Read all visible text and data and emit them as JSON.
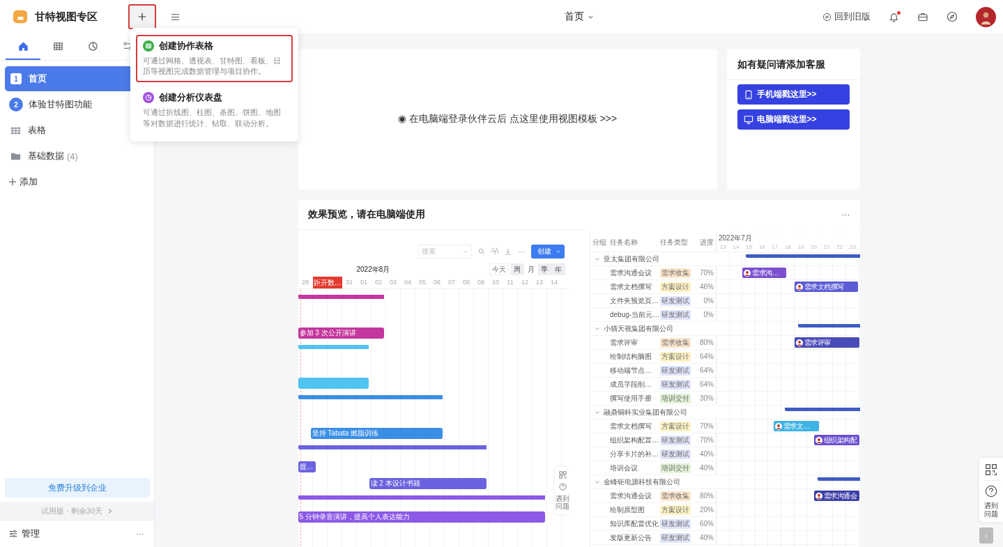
{
  "app": {
    "title": "甘特视图专区",
    "add_highlighted": true
  },
  "page_title": "首页",
  "header": {
    "old_version": "回到旧版",
    "notification_dot": true
  },
  "sidebar": {
    "tabs": [
      {
        "kind": "home",
        "selected": true
      },
      {
        "kind": "table",
        "selected": false
      },
      {
        "kind": "clock",
        "selected": false
      },
      {
        "kind": "filter",
        "selected": false
      }
    ],
    "items": [
      {
        "kind": "numbered",
        "badge": "1",
        "label": "首页",
        "selected": true
      },
      {
        "kind": "numbered",
        "badge": "2",
        "label": "体验甘特图功能",
        "selected": false
      },
      {
        "kind": "table",
        "label": "表格",
        "selected": false
      },
      {
        "kind": "folder",
        "label": "基础数据",
        "count": "(4)",
        "selected": false
      }
    ],
    "add": "添加",
    "upgrade": "免费升级到企业",
    "trial": "试用版 · 剩余30天",
    "manage": "管理",
    "more": "···"
  },
  "create_menu": [
    {
      "kind": "table",
      "title": "创建协作表格",
      "description": "可通过网格、透视表、甘特图、看板、日历等视图完成数据管理与项目协作。",
      "highlighted": true
    },
    {
      "kind": "dashboard",
      "title": "创建分析仪表盘",
      "description": "可通过折线图、柱图、条图、饼图、地图等对数据进行统计、钻取、联动分析。",
      "highlighted": false
    }
  ],
  "banner": {
    "text": "◉ 在电脑端登录伙伴云后 点这里使用视图模板 >>>"
  },
  "help_card": {
    "title": "如有疑问请添加客服",
    "buttons": [
      {
        "kind": "mobile",
        "label": "手机端戳这里>>"
      },
      {
        "kind": "desktop",
        "label": "电脑端戳这里>>"
      }
    ]
  },
  "preview": {
    "title": "效果预览，请在电脑端使用",
    "more": "···",
    "left": {
      "search_placeholder": "搜索",
      "more": "···",
      "create": "创建",
      "month": "2022年8月",
      "today": "今天",
      "scales": [
        {
          "label": "周",
          "selected": false
        },
        {
          "label": "月",
          "selected": true
        },
        {
          "label": "季",
          "selected": false
        },
        {
          "label": "年",
          "selected": false
        }
      ],
      "days": [
        {
          "kind": "day",
          "label": "28"
        },
        {
          "kind": "marker",
          "label": "距开数…"
        },
        {
          "kind": "day",
          "label": "31"
        },
        {
          "kind": "day",
          "label": "01"
        },
        {
          "kind": "day",
          "label": "02"
        },
        {
          "kind": "day",
          "label": "03"
        },
        {
          "kind": "day",
          "label": "04"
        },
        {
          "kind": "day",
          "label": "05"
        },
        {
          "kind": "day",
          "label": "06"
        },
        {
          "kind": "day",
          "label": "07"
        },
        {
          "kind": "day",
          "label": "08"
        },
        {
          "kind": "day",
          "label": "09"
        },
        {
          "kind": "day",
          "label": "10"
        },
        {
          "kind": "day",
          "label": "11"
        },
        {
          "kind": "day",
          "label": "12"
        },
        {
          "kind": "day",
          "label": "13"
        },
        {
          "kind": "day",
          "label": "14"
        }
      ],
      "bars": [
        {
          "kind": "summary",
          "color": "#c4379c"
        },
        {
          "kind": "empty"
        },
        {
          "kind": "task",
          "label": "参加 3 次公开演讲",
          "color": "#c4379c"
        },
        {
          "kind": "summary",
          "color": "#4fc3f2"
        },
        {
          "kind": "empty"
        },
        {
          "kind": "task",
          "color": "#4fc3f2"
        },
        {
          "kind": "summary",
          "color": "#3b8ee6"
        },
        {
          "kind": "empty"
        },
        {
          "kind": "task",
          "label": "坚持 Tabata 燃脂训练",
          "color": "#3b8ee6"
        },
        {
          "kind": "summary",
          "color": "#6b62e0"
        },
        {
          "kind": "task",
          "label": "提…",
          "color": "#6b62e0"
        },
        {
          "kind": "task",
          "label": "读 2 本设计书籍",
          "color": "#6b62e0"
        },
        {
          "kind": "summary",
          "color": "#8b59e6"
        },
        {
          "kind": "task",
          "label": "5 分钟录音演讲，提高个人表达能力",
          "color": "#8b59e6"
        }
      ],
      "help_label": "遇到问题"
    },
    "right": {
      "columns": [
        "分组",
        "任务名称",
        "任务类型",
        "进度"
      ],
      "month": "2022年7月",
      "days": [
        "13",
        "14",
        "15",
        "16",
        "17",
        "18",
        "19",
        "20",
        "21",
        "22",
        "23"
      ],
      "groups": [
        {
          "name": "亚太集团有限公司",
          "expanded": true,
          "tasks": [
            {
              "name": "需求沟通会议",
              "type": {
                "label": "需求收集",
                "color": "#fbe6cc"
              },
              "progress": "70%",
              "bar": {
                "label": "需求沟…",
                "color": "#7b4fd0"
              }
            },
            {
              "name": "需求文档撰写",
              "type": {
                "label": "方案设计",
                "color": "#fdf1c4"
              },
              "progress": "46%",
              "bar": {
                "label": "需求文档撰写",
                "color": "#5b5bd6"
              }
            },
            {
              "name": "文件夹预览页…",
              "type": {
                "label": "研发测试",
                "color": "#e1e5fa"
              },
              "progress": "0%"
            },
            {
              "name": "debug-当前元…",
              "type": {
                "label": "研发测试",
                "color": "#e1e5fa"
              },
              "progress": "0%"
            }
          ]
        },
        {
          "name": "小猫天视集团有限公司",
          "expanded": true,
          "tasks": [
            {
              "name": "需求评审",
              "type": {
                "label": "需求收集",
                "color": "#fbe6cc"
              },
              "progress": "80%",
              "bar": {
                "label": "需求评审",
                "color": "#4a4ab8"
              }
            },
            {
              "name": "绘制结构脑图",
              "type": {
                "label": "方案设计",
                "color": "#fdf1c4"
              },
              "progress": "64%"
            },
            {
              "name": "移动端节点…",
              "type": {
                "label": "研发测试",
                "color": "#e1e5fa"
              },
              "progress": "64%"
            },
            {
              "name": "成员字段削…",
              "type": {
                "label": "研发测试",
                "color": "#e1e5fa"
              },
              "progress": "64%"
            },
            {
              "name": "撰写使用手册",
              "type": {
                "label": "培训交付",
                "color": "#e2f2d6"
              },
              "progress": "30%"
            }
          ]
        },
        {
          "name": "融鼎铜科实业集团有限公司",
          "expanded": true,
          "tasks": [
            {
              "name": "需求文档撰写",
              "type": {
                "label": "方案设计",
                "color": "#fdf1c4"
              },
              "progress": "70%",
              "bar": {
                "label": "需求文…",
                "color": "#3fb3e6"
              }
            },
            {
              "name": "组织架构配置…",
              "type": {
                "label": "研发测试",
                "color": "#e1e5fa"
              },
              "progress": "70%",
              "bar": {
                "label": "组织架构配",
                "color": "#6b4fd0"
              }
            },
            {
              "name": "分享卡片的补…",
              "type": {
                "label": "研发测试",
                "color": "#e1e5fa"
              },
              "progress": "40%"
            },
            {
              "name": "培训会议",
              "type": {
                "label": "培训交付",
                "color": "#e2f2d6"
              },
              "progress": "40%"
            }
          ]
        },
        {
          "name": "金峰钜电源科技有限公司",
          "expanded": true,
          "tasks": [
            {
              "name": "需求沟通会议",
              "type": {
                "label": "需求收集",
                "color": "#fbe6cc"
              },
              "progress": "80%",
              "bar": {
                "label": "需求沟通会",
                "color": "#3d3fa8"
              }
            },
            {
              "name": "绘制原型图",
              "type": {
                "label": "方案设计",
                "color": "#fdf1c4"
              },
              "progress": "20%"
            },
            {
              "name": "知识库配置优化",
              "type": {
                "label": "研发测试",
                "color": "#e1e5fa"
              },
              "progress": "60%"
            },
            {
              "name": "发版更新公告",
              "type": {
                "label": "研发测试",
                "color": "#e1e5fa"
              },
              "progress": "40%"
            }
          ]
        }
      ]
    }
  },
  "float_help": {
    "label": "遇到问题"
  }
}
